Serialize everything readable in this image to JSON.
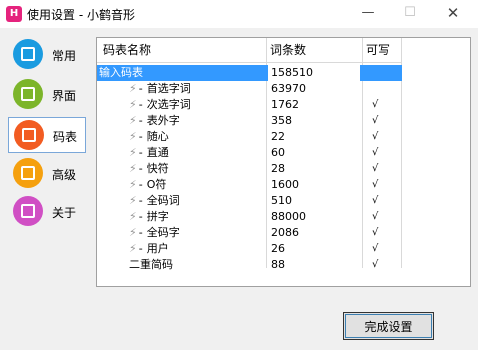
{
  "window": {
    "title": "使用设置 - 小鹤音形",
    "icon_letter": "H",
    "controls": {
      "minimize": "—",
      "maximize": "☐",
      "close": "✕"
    }
  },
  "sidebar": {
    "items": [
      {
        "label": "常用",
        "icon": "settings-square-icon",
        "color": "#1a9be0",
        "active": false
      },
      {
        "label": "界面",
        "icon": "layout-icon",
        "color": "#7cb52a",
        "active": false
      },
      {
        "label": "码表",
        "icon": "table-icon",
        "color": "#f25c22",
        "active": true
      },
      {
        "label": "高级",
        "icon": "advanced-icon",
        "color": "#f5a00e",
        "active": false
      },
      {
        "label": "关于",
        "icon": "about-icon",
        "color": "#d04fc4",
        "active": false
      }
    ]
  },
  "table": {
    "headers": {
      "name": "码表名称",
      "count": "词条数",
      "writable": "可写"
    },
    "rows": [
      {
        "name": "输入码表",
        "count": "158510",
        "writable": "",
        "selected": true,
        "child": false
      },
      {
        "name": "首选字词",
        "count": "63970",
        "writable": "",
        "selected": false,
        "child": true
      },
      {
        "name": "次选字词",
        "count": "1762",
        "writable": "√",
        "selected": false,
        "child": true
      },
      {
        "name": "表外字",
        "count": "358",
        "writable": "√",
        "selected": false,
        "child": true
      },
      {
        "name": "随心",
        "count": "22",
        "writable": "√",
        "selected": false,
        "child": true
      },
      {
        "name": "直通",
        "count": "60",
        "writable": "√",
        "selected": false,
        "child": true
      },
      {
        "name": "快符",
        "count": "28",
        "writable": "√",
        "selected": false,
        "child": true
      },
      {
        "name": "O符",
        "count": "1600",
        "writable": "√",
        "selected": false,
        "child": true
      },
      {
        "name": "全码词",
        "count": "510",
        "writable": "√",
        "selected": false,
        "child": true
      },
      {
        "name": "拼字",
        "count": "88000",
        "writable": "√",
        "selected": false,
        "child": true
      },
      {
        "name": "全码字",
        "count": "2086",
        "writable": "√",
        "selected": false,
        "child": true
      },
      {
        "name": "用户",
        "count": "26",
        "writable": "√",
        "selected": false,
        "child": true
      },
      {
        "name": "二重简码",
        "count": "88",
        "writable": "√",
        "selected": false,
        "child": false
      }
    ]
  },
  "footer": {
    "finish_button": "完成设置"
  }
}
